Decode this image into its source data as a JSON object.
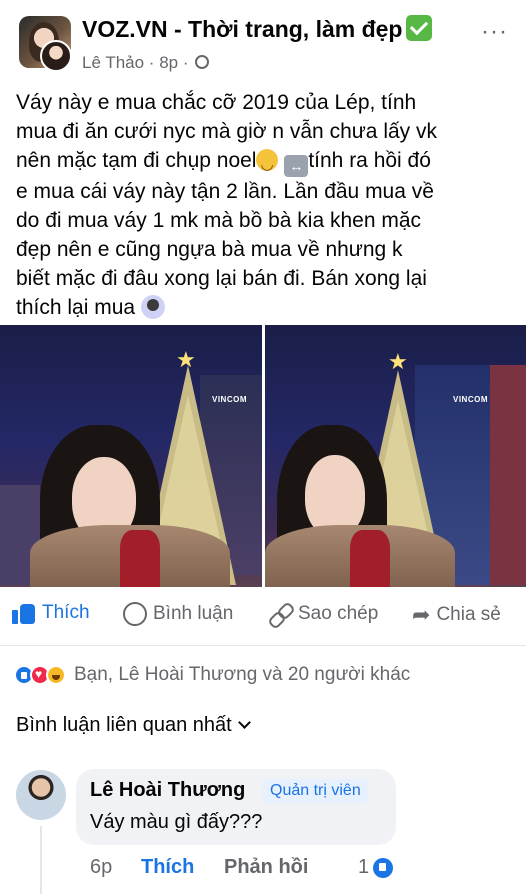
{
  "header": {
    "group_name": "VOZ.VN - Thời trang, làm đẹp",
    "author": "Lê Thảo",
    "time": "8p",
    "separator": " · ",
    "more": "···"
  },
  "post": {
    "line1": "Váy này e mua chắc cỡ 2019 của Lép, tính",
    "line2": "mua đi ăn cưới nyc mà giờ n vẫn chưa lấy vk",
    "line3a": "nên mặc tạm đi chụp noel",
    "line3b": "tính ra hồi đó",
    "line4": "e mua cái váy này tận 2 lần. Lần đầu mua về",
    "line5": "do đi mua váy 1 mk mà bồ bà kia khen mặc",
    "line6": "đẹp nên e cũng ngựa bà mua về nhưng k",
    "line7": "biết mặc đi đâu xong lại bán đi. Bán xong lại",
    "line8": "thích lại mua"
  },
  "photos": {
    "sign_text": "VINCOM"
  },
  "actions": {
    "like": "Thích",
    "comment": "Bình luận",
    "copy": "Sao chép",
    "share": "Chia sẻ"
  },
  "reactions": {
    "summary": "Bạn, Lê Hoài Thương và 20 người khác"
  },
  "sort": {
    "label": "Bình luận liên quan nhất"
  },
  "comment": {
    "author": "Lê Hoài Thương",
    "badge": "Quản trị viên",
    "text": "Váy màu gì đấy???",
    "time": "6p",
    "like": "Thích",
    "reply": "Phản hồi",
    "like_count": "1"
  },
  "colors": {
    "accent": "#1b74e4",
    "secondary_text": "#65676b",
    "verified": "#57b846"
  }
}
